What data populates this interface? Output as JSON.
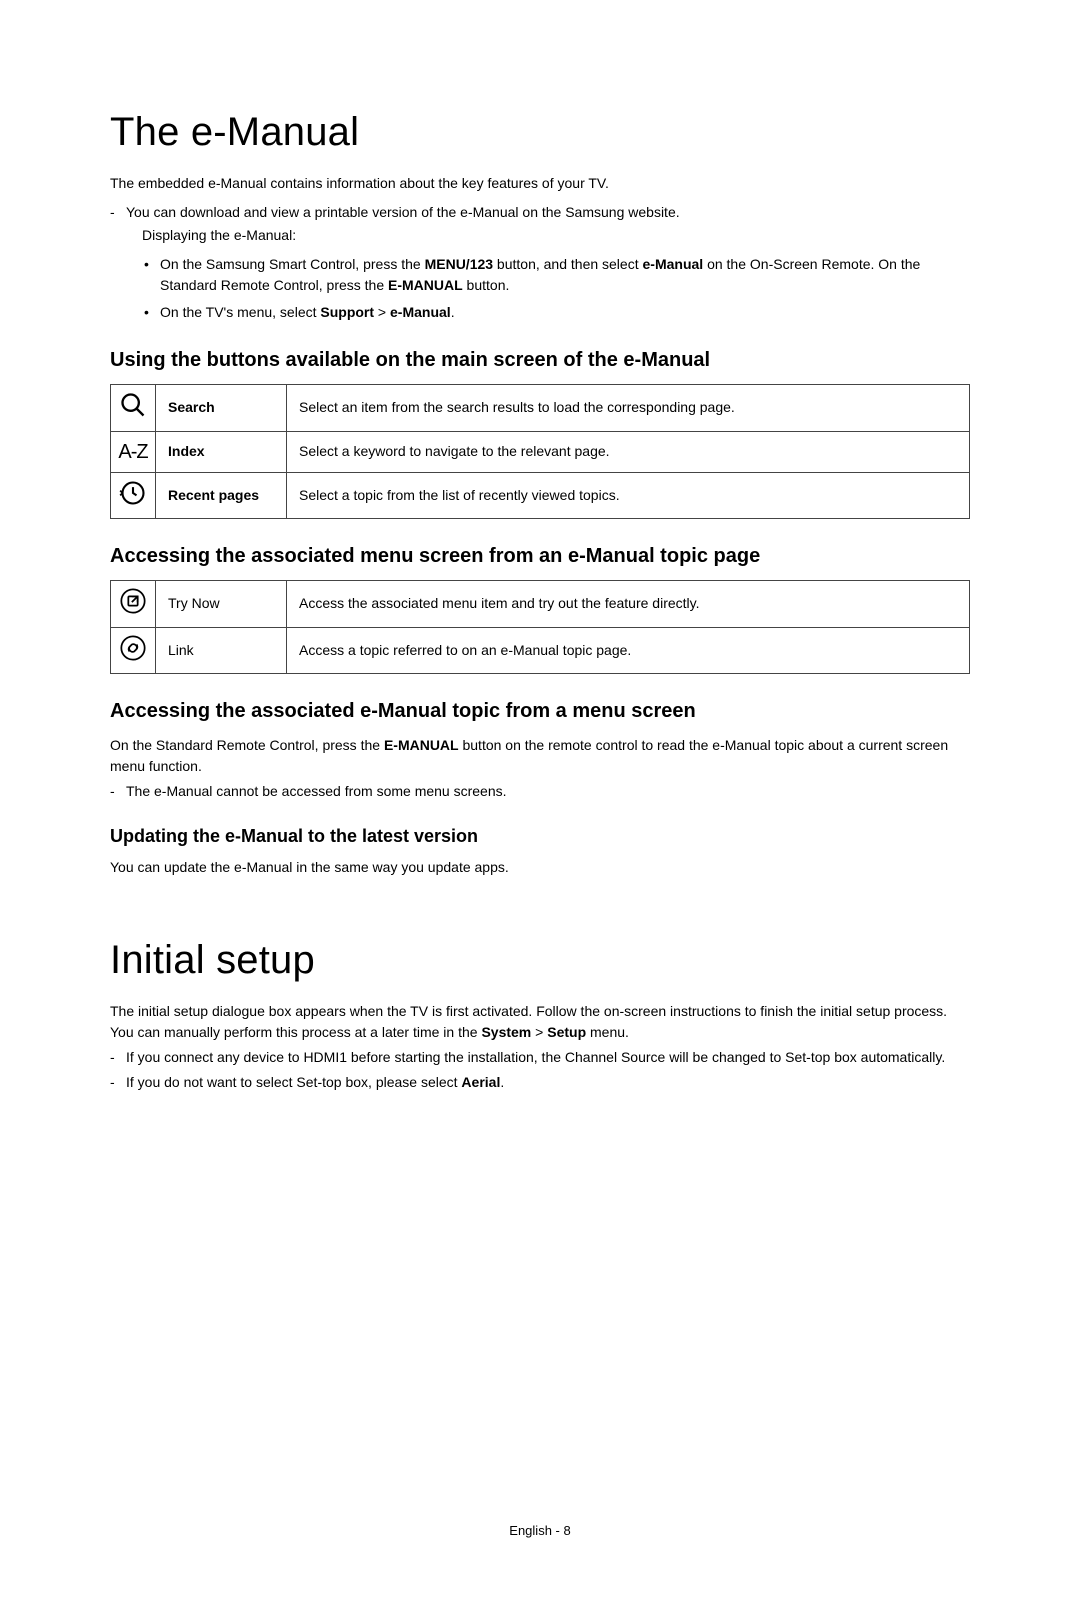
{
  "section1": {
    "heading": "The e-Manual",
    "intro": "The embedded e-Manual contains information about the key features of your TV.",
    "hyphen1": "You can download and view a printable version of the e-Manual on the Samsung website.",
    "sub1": "Displaying the e-Manual:",
    "bullet1_pre": "On the Samsung Smart Control, press the ",
    "bullet1_bold1": "MENU/123",
    "bullet1_mid1": " button, and then select ",
    "bullet1_bold2": "e-Manual",
    "bullet1_mid2": " on the On-Screen Remote. On the Standard Remote Control, press the ",
    "bullet1_bold3": "E-MANUAL",
    "bullet1_end": " button.",
    "bullet2_pre": "On the TV's menu, select ",
    "bullet2_bold1": "Support",
    "bullet2_sep": " > ",
    "bullet2_bold2": "e-Manual",
    "bullet2_end": "."
  },
  "table1_heading": "Using the buttons available on the main screen of the e-Manual",
  "table1": {
    "row1": {
      "label": "Search",
      "desc": "Select an item from the search results to load the corresponding page."
    },
    "row2": {
      "label": "Index",
      "desc": "Select a keyword to navigate to the relevant page."
    },
    "row3": {
      "label": "Recent pages",
      "desc": "Select a topic from the list of recently viewed topics."
    }
  },
  "table2_heading": "Accessing the associated menu screen from an e-Manual topic page",
  "table2": {
    "row1": {
      "label": "Try Now",
      "desc": "Access the associated menu item and try out the feature directly."
    },
    "row2": {
      "label": "Link",
      "desc": "Access a topic referred to on an e-Manual topic page."
    }
  },
  "sub2": {
    "heading": "Accessing the associated e-Manual topic from a menu screen",
    "body_pre": "On the Standard Remote Control, press the ",
    "body_bold": "E-MANUAL",
    "body_end": " button on the remote control to read the e-Manual topic about a current screen menu function.",
    "hyphen": "The e-Manual cannot be accessed from some menu screens."
  },
  "sub3": {
    "heading": "Updating the e-Manual to the latest version",
    "body": "You can update the e-Manual in the same way you update apps."
  },
  "section2": {
    "heading": "Initial setup",
    "intro_pre": "The initial setup dialogue box appears when the TV is first activated. Follow the on-screen instructions to finish the initial setup process. You can manually perform this process at a later time in the ",
    "intro_bold1": "System",
    "intro_sep": " > ",
    "intro_bold2": "Setup",
    "intro_end": " menu.",
    "hyphen1": "If you connect any device to HDMI1 before starting the installation, the Channel Source will be changed to Set-top box automatically.",
    "hyphen2_pre": "If you do not want to select Set-top box, please select ",
    "hyphen2_bold": "Aerial",
    "hyphen2_end": "."
  },
  "footer": "English - 8",
  "icons": {
    "az": "A-Z"
  }
}
